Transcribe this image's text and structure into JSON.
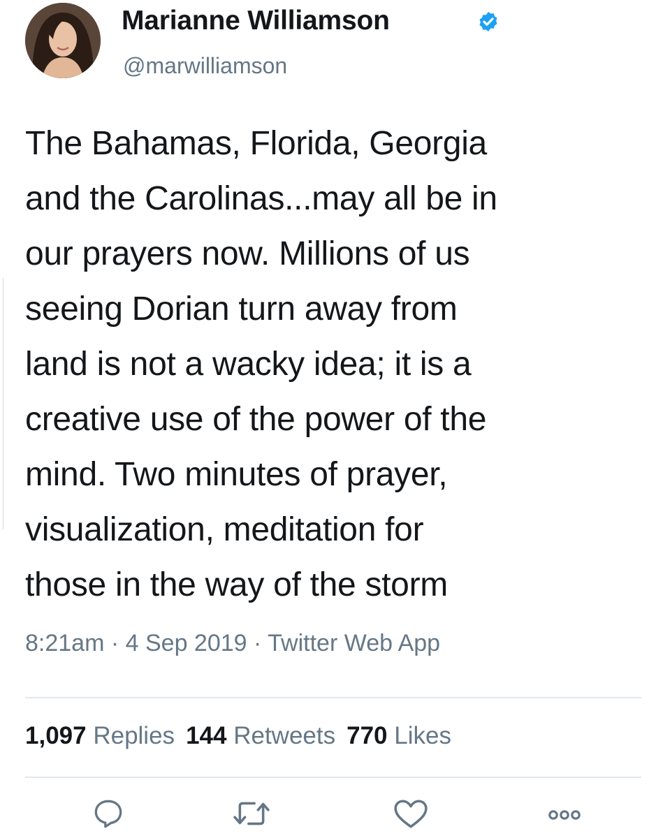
{
  "author": {
    "display_name": "Marianne Williamson",
    "handle": "@marwilliamson",
    "verified": true
  },
  "tweet": {
    "lines": [
      "The Bahamas, Florida, Georgia",
      "and the Carolinas...may all be in",
      "our prayers now. Millions of us",
      "seeing Dorian turn away from",
      "land is not a wacky idea; it is a",
      "creative use of the power of the",
      "mind. Two minutes of prayer,",
      "visualization, meditation for",
      "those in the way of the storm"
    ],
    "timestamp_line": "8:21am · 4 Sep 2019 · Twitter Web App"
  },
  "stats": {
    "replies_count": "1,097",
    "replies_label": "Replies",
    "retweets_count": "144",
    "retweets_label": "Retweets",
    "likes_count": "770",
    "likes_label": "Likes"
  },
  "icons": {
    "reply": "reply-icon",
    "retweet": "retweet-icon",
    "like": "like-icon",
    "more": "more-icon",
    "verified": "verified-badge-icon"
  },
  "colors": {
    "text": "#14171a",
    "secondary": "#657786",
    "verified_blue": "#1da1f2",
    "divider": "#e1e8ed"
  }
}
